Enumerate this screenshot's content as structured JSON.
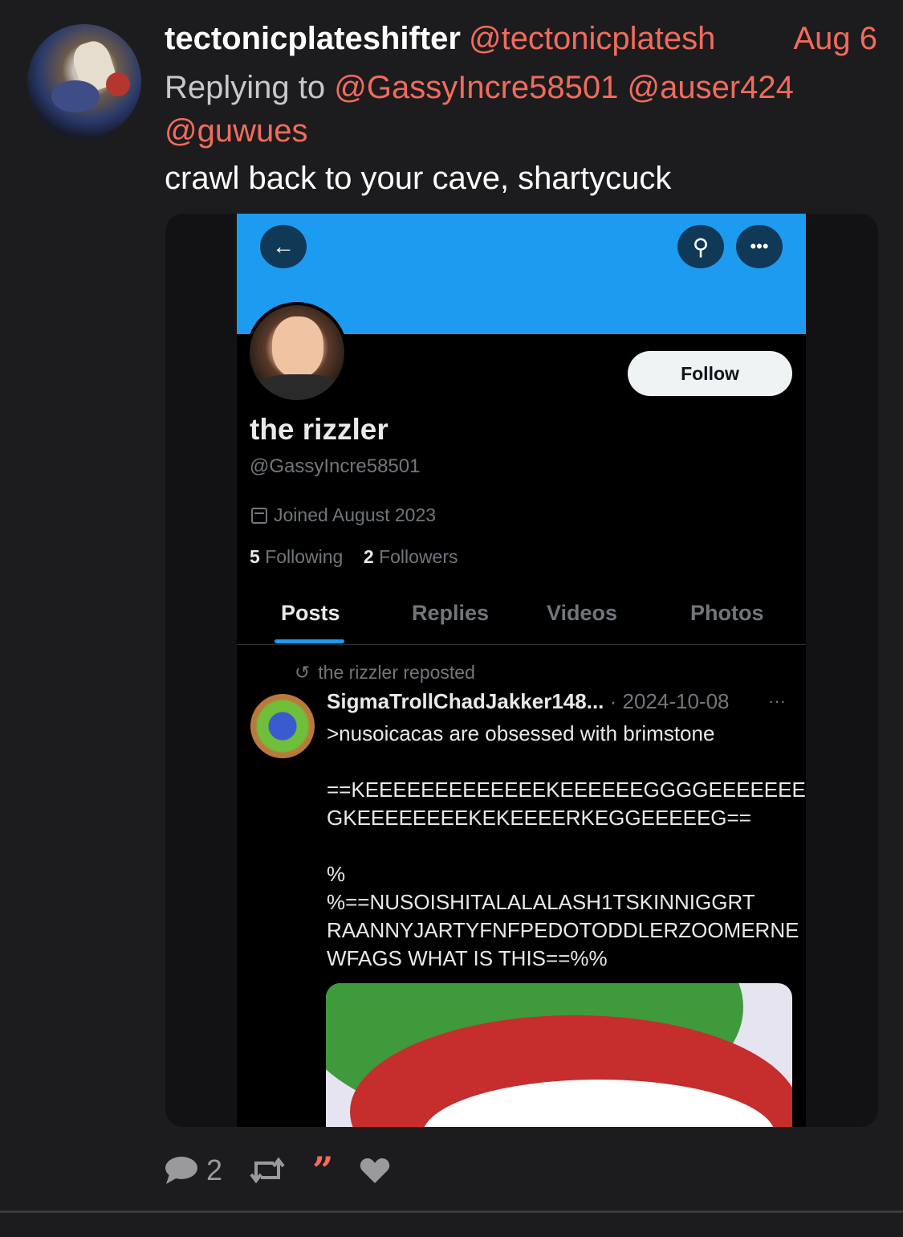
{
  "post": {
    "username": "tectonicplateshifter",
    "handle": "@tectonicplatesh",
    "date": "Aug 6",
    "replying_prefix": "Replying to",
    "mentions": [
      "@GassyIncre58501",
      "@auser424",
      "@guwues"
    ],
    "text": "crawl back to your cave, shartycuck"
  },
  "screenshot": {
    "follow_label": "Follow",
    "display_name": "the rizzler",
    "handle": "@GassyIncre58501",
    "joined": "Joined August 2023",
    "following_count": "5",
    "following_label": "Following",
    "followers_count": "2",
    "followers_label": "Followers",
    "tabs": [
      "Posts",
      "Replies",
      "Videos",
      "Photos"
    ],
    "repost_label": "the rizzler reposted",
    "post_author": "SigmaTrollChadJakker148...",
    "post_date": "· 2024-10-08",
    "post_more": "···",
    "post_body": ">nusoicacas are obsessed with brimstone\n\n==KEEEEEEEEEEEEEKEEEEEEGGGGEEEEEEEE GKEEEEEEEEKEKEEEERKEGGEEEEEG==\n\n%\n%==NUSOISHITALALALASH1TSKINNIGGRT RAANNYJARTYFNFPEDOTODDLERZOOMERNE WFAGS WHAT IS THIS==%%"
  },
  "actions": {
    "reply_count": "2"
  },
  "icons": [
    "back-arrow-icon",
    "search-icon",
    "more-icon",
    "calendar-icon",
    "repost-icon",
    "comment-icon",
    "retweet-icon",
    "quote-icon",
    "heart-icon"
  ],
  "colors": {
    "background": "#1c1c1e",
    "accent": "#f26b5b",
    "twitter_blue": "#1d9bf0"
  }
}
